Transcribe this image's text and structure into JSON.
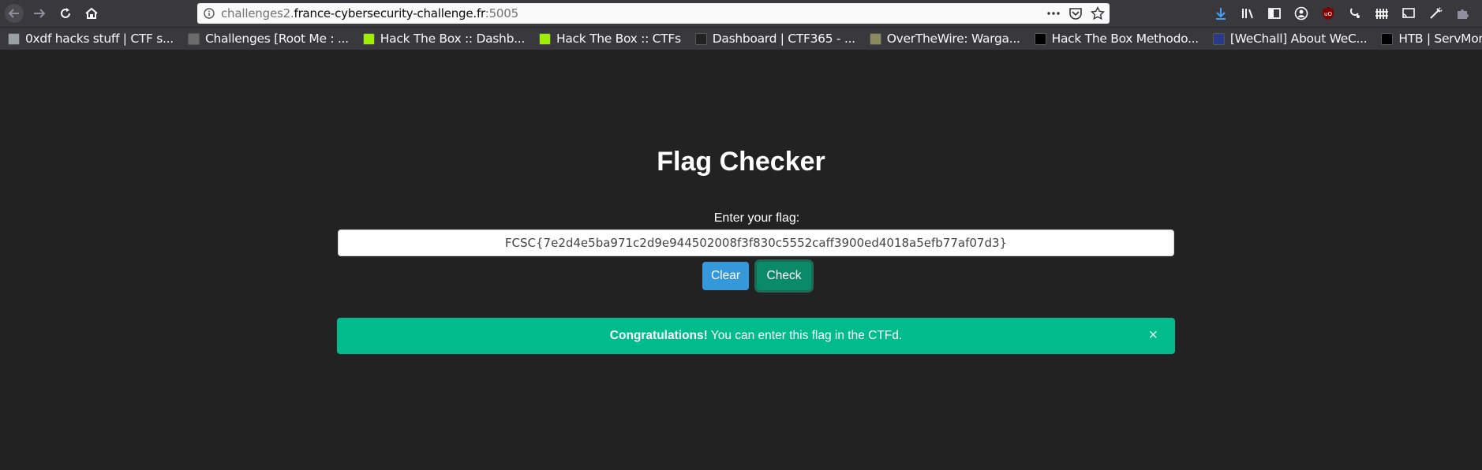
{
  "browser": {
    "url_prefix": "challenges2.",
    "url_host": "france-cybersecurity-challenge.fr",
    "url_port": ":5005",
    "bookmarks": [
      {
        "label": "0xdf hacks stuff | CTF s...",
        "color": "#9aa0a6"
      },
      {
        "label": "Challenges [Root Me : ...",
        "color": "#6b6b6b"
      },
      {
        "label": "Hack The Box :: Dashb...",
        "color": "#9fef00"
      },
      {
        "label": "Hack The Box :: CTFs",
        "color": "#9fef00"
      },
      {
        "label": "Dashboard | CTF365 - ...",
        "color": "#222222"
      },
      {
        "label": "OverTheWire: Warga...",
        "color": "#8a8a5c"
      },
      {
        "label": "Hack The Box Methodo...",
        "color": "#000000"
      },
      {
        "label": "[WeChall] About WeC...",
        "color": "#2a3a8a"
      },
      {
        "label": "HTB | ServMon CTF W...",
        "color": "#000000"
      }
    ]
  },
  "page": {
    "title": "Flag Checker",
    "input_label": "Enter your flag:",
    "flag_value": "FCSC{7e2d4e5ba971c2d9e944502008f3f830c5552caff3900ed4018a5efb77af07d3}",
    "clear_label": "Clear",
    "check_label": "Check",
    "alert_strong": "Congratulations!",
    "alert_text": "You can enter this flag in the CTFd.",
    "alert_close": "×"
  },
  "colors": {
    "background": "#222222",
    "success": "#00bc8c",
    "clear_button": "#3498db",
    "check_button": "#0b8a6a"
  }
}
